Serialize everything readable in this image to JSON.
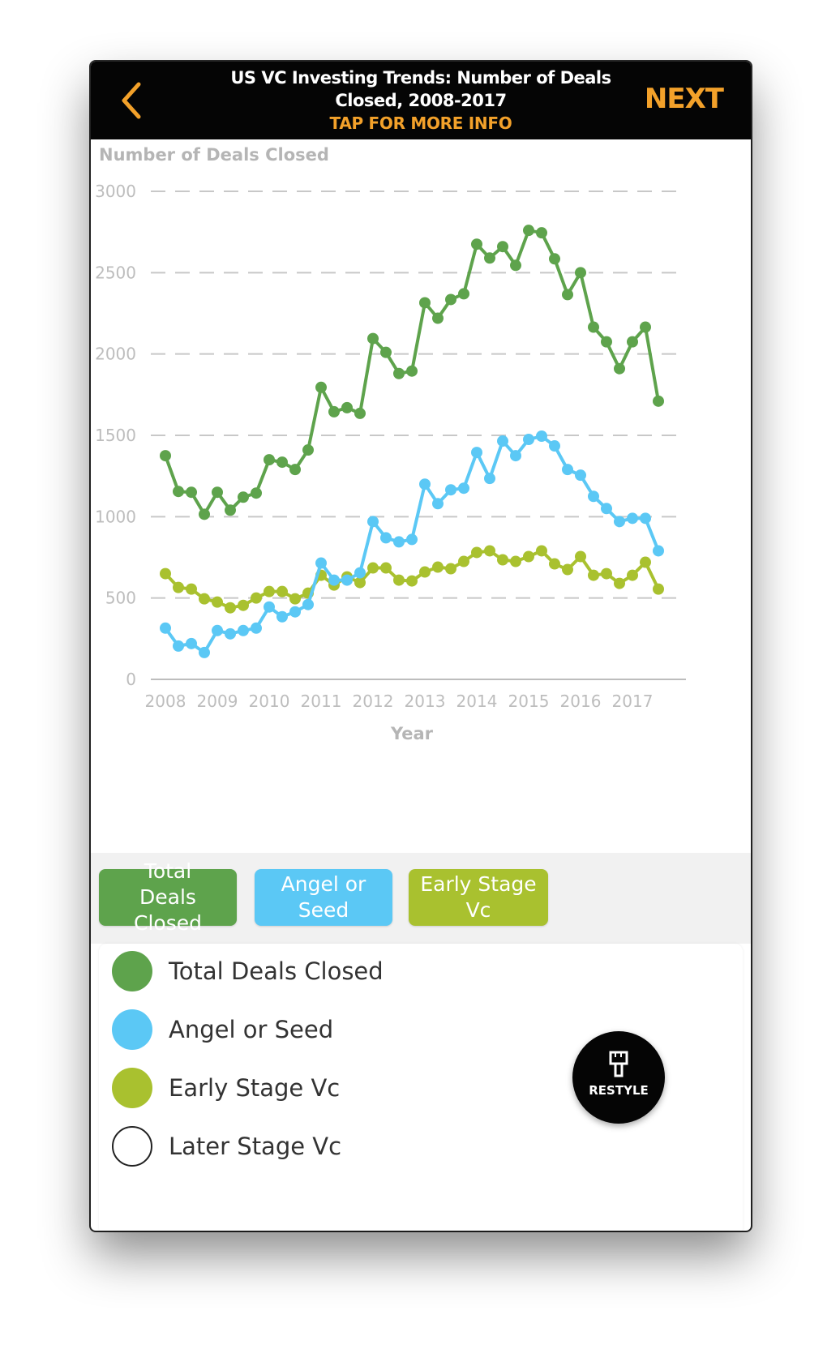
{
  "header": {
    "title_line1": "US VC Investing Trends: Number of Deals",
    "title_line2": "Closed, 2008-2017",
    "tap_info": "TAP FOR MORE INFO",
    "next_label": "NEXT"
  },
  "colors": {
    "accent": "#f3a12a",
    "total": "#5ea34c",
    "angel": "#5bc8f5",
    "early": "#a9c12f",
    "grid": "#c8c8c8",
    "axis_text": "#bdbdbd"
  },
  "chart_data": {
    "type": "line",
    "ylabel": "Number of Deals Closed",
    "xlabel": "Year",
    "ylim": [
      0,
      3000
    ],
    "yticks": [
      0,
      500,
      1000,
      1500,
      2000,
      2500,
      3000
    ],
    "xlim": [
      2008,
      2018
    ],
    "xticks": [
      "2008",
      "2009",
      "2010",
      "2011",
      "2012",
      "2013",
      "2014",
      "2015",
      "2016",
      "2017"
    ],
    "grid": "horizontal dashed",
    "x": [
      2008.0,
      2008.25,
      2008.5,
      2008.75,
      2009.0,
      2009.25,
      2009.5,
      2009.75,
      2010.0,
      2010.25,
      2010.5,
      2010.75,
      2011.0,
      2011.25,
      2011.5,
      2011.75,
      2012.0,
      2012.25,
      2012.5,
      2012.75,
      2013.0,
      2013.25,
      2013.5,
      2013.75,
      2014.0,
      2014.25,
      2014.5,
      2014.75,
      2015.0,
      2015.25,
      2015.5,
      2015.75,
      2016.0,
      2016.25,
      2016.5,
      2016.75,
      2017.0,
      2017.25,
      2017.5
    ],
    "series": [
      {
        "name": "Total Deals Closed",
        "color": "#5ea34c",
        "values": [
          1375,
          1155,
          1150,
          1015,
          1150,
          1040,
          1120,
          1145,
          1350,
          1335,
          1290,
          1410,
          1795,
          1645,
          1670,
          1635,
          2095,
          2010,
          1880,
          1895,
          2315,
          2220,
          2335,
          2370,
          2675,
          2590,
          2660,
          2545,
          2760,
          2745,
          2585,
          2365,
          2500,
          2165,
          2075,
          1910,
          2075,
          2165,
          1710
        ]
      },
      {
        "name": "Angel or Seed",
        "color": "#5bc8f5",
        "values": [
          315,
          205,
          220,
          165,
          300,
          280,
          300,
          315,
          445,
          385,
          415,
          460,
          715,
          610,
          610,
          655,
          970,
          870,
          845,
          860,
          1200,
          1080,
          1165,
          1175,
          1395,
          1235,
          1465,
          1375,
          1475,
          1495,
          1435,
          1290,
          1255,
          1125,
          1050,
          970,
          990,
          990,
          790
        ]
      },
      {
        "name": "Early Stage Vc",
        "color": "#a9c12f",
        "values": [
          650,
          565,
          555,
          495,
          475,
          440,
          455,
          500,
          540,
          540,
          495,
          530,
          640,
          580,
          630,
          595,
          685,
          685,
          610,
          605,
          660,
          690,
          680,
          725,
          780,
          790,
          735,
          725,
          755,
          790,
          710,
          675,
          755,
          640,
          650,
          590,
          640,
          720,
          555
        ]
      },
      {
        "name": "Later Stage Vc",
        "color": "#ffffff",
        "values": []
      }
    ]
  },
  "series_buttons": [
    {
      "label": "Total Deals Closed",
      "color": "#5ea34c"
    },
    {
      "label": "Angel or Seed",
      "color": "#5bc8f5"
    },
    {
      "label": "Early Stage Vc",
      "color": "#a9c12f"
    }
  ],
  "legend": [
    {
      "label": "Total Deals Closed",
      "color": "#5ea34c"
    },
    {
      "label": "Angel or Seed",
      "color": "#5bc8f5"
    },
    {
      "label": "Early Stage Vc",
      "color": "#a9c12f"
    },
    {
      "label": "Later Stage Vc",
      "color": "#ffffff"
    }
  ],
  "restyle": {
    "label": "RESTYLE",
    "icon": "paintbrush-icon"
  }
}
